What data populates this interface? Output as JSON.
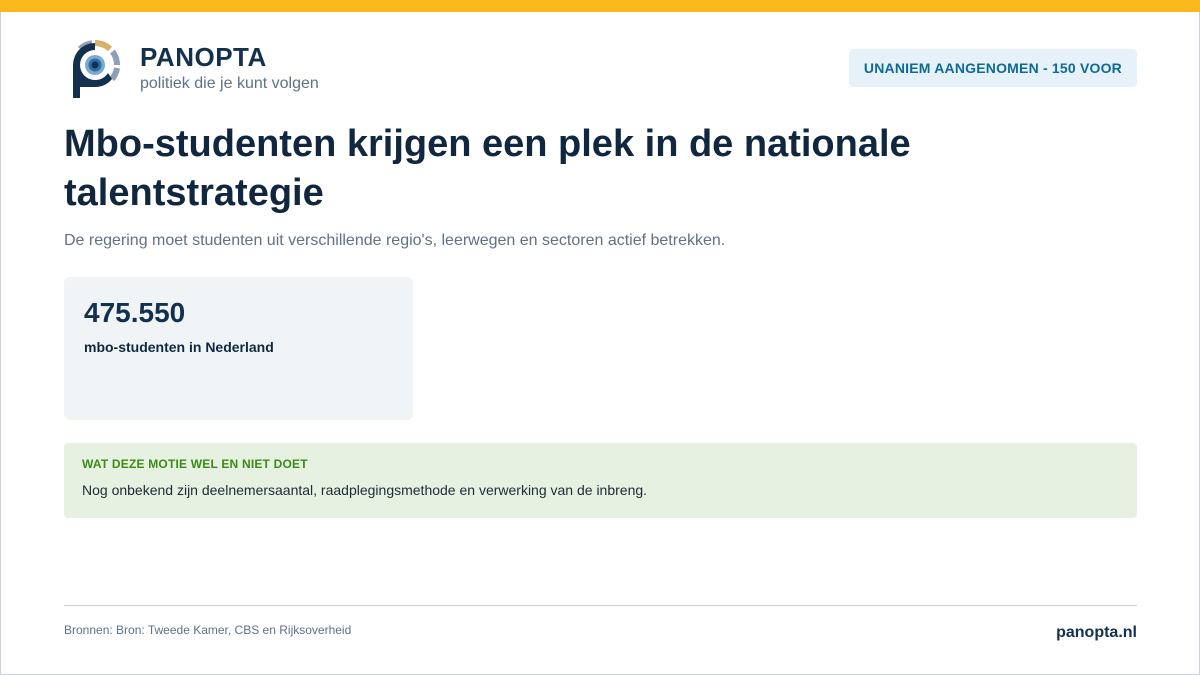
{
  "brand": {
    "name": "PANOPTA",
    "tagline": "politiek die je kunt volgen",
    "colors": {
      "accent": "#fbb81a",
      "navy": "#14304f",
      "eye_blue": "#2a6fa8",
      "eye_light": "#7da9d0",
      "segment_gold": "#d9b26a",
      "segment_gray": "#8ea0b4"
    }
  },
  "vote_badge": "UNANIEM AANGENOMEN - 150 VOOR",
  "title": "Mbo-studenten krijgen een plek in de nationale talentstrategie",
  "subtitle": "De regering moet studenten uit verschillende regio's, leerwegen en sectoren actief betrekken.",
  "stat": {
    "value": "475.550",
    "label": "mbo-studenten in Nederland"
  },
  "note": {
    "heading": "WAT DEZE MOTIE WEL EN NIET DOET",
    "text": "Nog onbekend zijn deelnemersaantal, raadplegingsmethode en verwerking van de inbreng."
  },
  "footer": {
    "sources": "Bronnen: Bron: Tweede Kamer, CBS en Rijksoverheid",
    "site": "panopta.nl"
  }
}
